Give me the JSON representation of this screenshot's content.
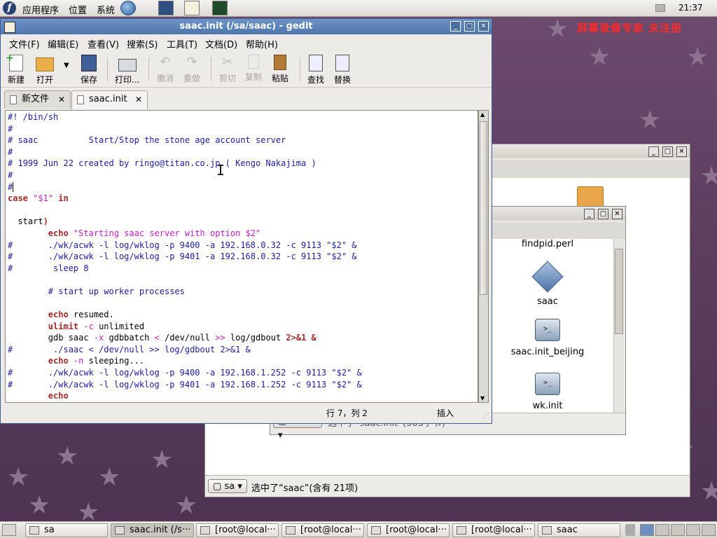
{
  "top_panel": {
    "menus": [
      "应用程序",
      "位置",
      "系统"
    ],
    "clock": "21:37"
  },
  "watermark": "屏幕录像专家 未注册",
  "file_manager_back": {
    "title": "",
    "location_button": "sa",
    "status_text": "选中了“saac”(含有 21项)"
  },
  "file_manager_front": {
    "title": "",
    "location_button": "saac",
    "status_text": "选中了“saac.init”(363字节)",
    "items": [
      {
        "name": "findpid.perl",
        "icon": "script-file-icon"
      },
      {
        "name": "saac",
        "icon": "executable-icon"
      },
      {
        "name": "saac.init_beijing",
        "icon": "terminal-script-icon"
      },
      {
        "name": "wk.init",
        "icon": "terminal-script-icon"
      }
    ]
  },
  "gedit": {
    "title": "saac.init (/sa/saac) - gedit",
    "menu": [
      "文件(F)",
      "编辑(E)",
      "查看(V)",
      "搜索(S)",
      "工具(T)",
      "文档(D)",
      "帮助(H)"
    ],
    "toolbar": {
      "new": "新建",
      "open": "打开",
      "save": "保存",
      "print": "打印...",
      "undo": "撤消",
      "redo": "重做",
      "cut": "剪切",
      "copy": "复制",
      "paste": "粘贴",
      "find": "查找",
      "replace": "替换"
    },
    "tabs": [
      {
        "label": "新文件",
        "active": false
      },
      {
        "label": "saac.init",
        "active": true
      }
    ],
    "code_lines": [
      [
        {
          "t": "#! /bin/sh",
          "c": "comment"
        }
      ],
      [
        {
          "t": "#",
          "c": "comment"
        }
      ],
      [
        {
          "t": "# saac          Start/Stop the stone age account server",
          "c": "comment"
        }
      ],
      [
        {
          "t": "#",
          "c": "comment"
        }
      ],
      [
        {
          "t": "# 1999 Jun 22 created by ringo@titan.co.jp ( Kengo Nakajima )",
          "c": "comment"
        }
      ],
      [
        {
          "t": "#",
          "c": "comment"
        }
      ],
      [
        {
          "t": "#",
          "c": "comment"
        }
      ],
      [
        {
          "t": "case",
          "c": "kw"
        },
        {
          "t": " ",
          "c": "plain"
        },
        {
          "t": "\"$1\"",
          "c": "str"
        },
        {
          "t": " ",
          "c": "plain"
        },
        {
          "t": "in",
          "c": "kw"
        }
      ],
      [
        {
          "t": "",
          "c": "plain"
        }
      ],
      [
        {
          "t": "  start",
          "c": "plain"
        },
        {
          "t": ")",
          "c": "kw"
        }
      ],
      [
        {
          "t": "        ",
          "c": "plain"
        },
        {
          "t": "echo",
          "c": "kw"
        },
        {
          "t": " ",
          "c": "plain"
        },
        {
          "t": "\"Starting saac server with option $2\"",
          "c": "str"
        }
      ],
      [
        {
          "t": "#       ./wk/acwk -l log/wklog -p 9400 -a 192.168.0.32 -c 9113 \"$2\" &",
          "c": "comment"
        }
      ],
      [
        {
          "t": "#       ./wk/acwk -l log/wklog -p 9401 -a 192.168.0.32 -c 9113 \"$2\" &",
          "c": "comment"
        }
      ],
      [
        {
          "t": "#        sleep 8",
          "c": "comment"
        }
      ],
      [
        {
          "t": "",
          "c": "plain"
        }
      ],
      [
        {
          "t": "        # start up worker processes",
          "c": "comment"
        }
      ],
      [
        {
          "t": "",
          "c": "plain"
        }
      ],
      [
        {
          "t": "        ",
          "c": "plain"
        },
        {
          "t": "echo",
          "c": "kw"
        },
        {
          "t": " resumed.",
          "c": "plain"
        }
      ],
      [
        {
          "t": "        ",
          "c": "plain"
        },
        {
          "t": "ulimit",
          "c": "kw"
        },
        {
          "t": " ",
          "c": "plain"
        },
        {
          "t": "-c",
          "c": "str"
        },
        {
          "t": " unlimited",
          "c": "plain"
        }
      ],
      [
        {
          "t": "        gdb saac ",
          "c": "plain"
        },
        {
          "t": "-x",
          "c": "str"
        },
        {
          "t": " gdbbatch ",
          "c": "plain"
        },
        {
          "t": "<",
          "c": "str"
        },
        {
          "t": " /dev/null ",
          "c": "plain"
        },
        {
          "t": ">>",
          "c": "str"
        },
        {
          "t": " log/gdbout ",
          "c": "plain"
        },
        {
          "t": "2>&1 &",
          "c": "kw"
        }
      ],
      [
        {
          "t": "#        ./saac < /dev/null >> log/gdbout 2>&1 &",
          "c": "comment"
        }
      ],
      [
        {
          "t": "        ",
          "c": "plain"
        },
        {
          "t": "echo",
          "c": "kw"
        },
        {
          "t": " ",
          "c": "plain"
        },
        {
          "t": "-n",
          "c": "str"
        },
        {
          "t": " sleeping...",
          "c": "plain"
        }
      ],
      [
        {
          "t": "#       ./wk/acwk -l log/wklog -p 9400 -a 192.168.1.252 -c 9113 \"$2\" &",
          "c": "comment"
        }
      ],
      [
        {
          "t": "#       ./wk/acwk -l log/wklog -p 9401 -a 192.168.1.252 -c 9113 \"$2\" &",
          "c": "comment"
        }
      ],
      [
        {
          "t": "        ",
          "c": "plain"
        },
        {
          "t": "echo",
          "c": "kw"
        }
      ]
    ],
    "status": {
      "position": "行 7，列 2",
      "mode": "插入"
    }
  },
  "taskbar": {
    "tasks": [
      {
        "label": "sa",
        "active": false
      },
      {
        "label": "saac.init (/s···",
        "active": true
      },
      {
        "label": "[root@local···",
        "active": false
      },
      {
        "label": "[root@local···",
        "active": false
      },
      {
        "label": "[root@local···",
        "active": false
      },
      {
        "label": "[root@local···",
        "active": false
      },
      {
        "label": "saac",
        "active": false
      }
    ]
  },
  "colors": {
    "title_active": "#5a82b8",
    "comment": "#1c1c9e",
    "keyword": "#a52a2a",
    "string": "#c020c0",
    "watermark": "#ff2a2a"
  }
}
